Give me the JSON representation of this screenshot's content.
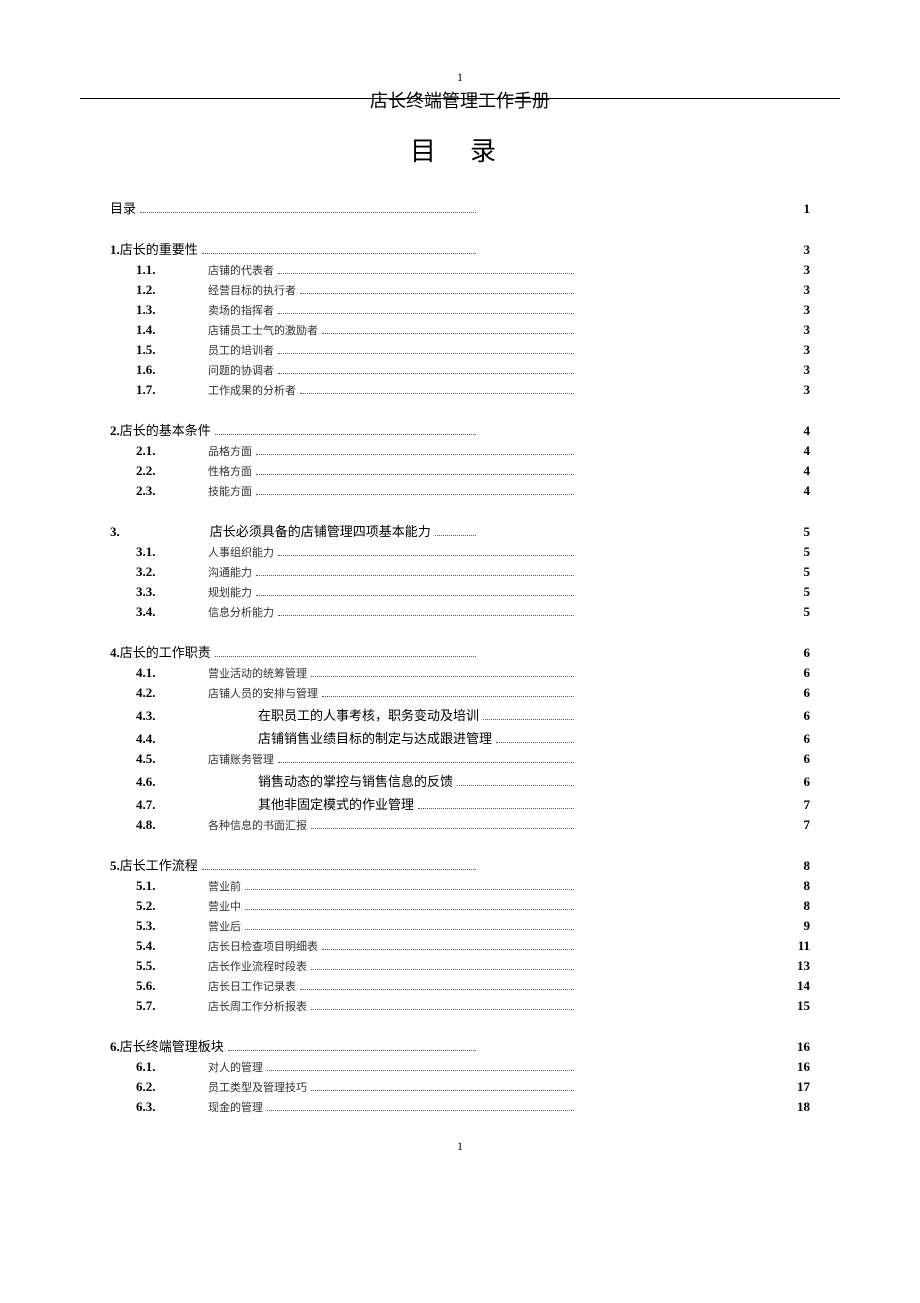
{
  "header": {
    "topnum": "1",
    "title": "店长终端管理工作手册"
  },
  "main_title": "目录",
  "footer": "1",
  "toc": [
    {
      "type": "top",
      "num": "",
      "label": "目录",
      "page": "1"
    },
    {
      "type": "top",
      "num": "1.",
      "label": "店长的重要性",
      "page": "3"
    },
    {
      "type": "sub",
      "num": "1.1.",
      "label": "店铺的代表者",
      "page": "3"
    },
    {
      "type": "sub",
      "num": "1.2.",
      "label": "经营目标的执行者",
      "page": "3"
    },
    {
      "type": "sub",
      "num": "1.3.",
      "label": "卖场的指挥者",
      "page": "3"
    },
    {
      "type": "sub",
      "num": "1.4.",
      "label": "店铺员工士气的激励者",
      "page": "3"
    },
    {
      "type": "sub",
      "num": "1.5.",
      "label": "员工的培训者",
      "page": "3"
    },
    {
      "type": "sub",
      "num": "1.6.",
      "label": "问题的协调者",
      "page": "3"
    },
    {
      "type": "sub",
      "num": "1.7.",
      "label": "工作成果的分析者",
      "page": "3"
    },
    {
      "type": "top",
      "num": "2.",
      "label": "店长的基本条件",
      "page": "4"
    },
    {
      "type": "sub",
      "num": "2.1.",
      "label": "品格方面",
      "page": "4"
    },
    {
      "type": "sub",
      "num": "2.2.",
      "label": "性格方面",
      "page": "4"
    },
    {
      "type": "sub",
      "num": "2.3.",
      "label": "技能方面",
      "page": "4"
    },
    {
      "type": "top-big",
      "num": "3.",
      "label": "店长必须具备的店铺管理四项基本能力",
      "page": "5"
    },
    {
      "type": "sub",
      "num": "3.1.",
      "label": "人事组织能力",
      "page": "5"
    },
    {
      "type": "sub",
      "num": "3.2.",
      "label": "沟通能力",
      "page": "5"
    },
    {
      "type": "sub",
      "num": "3.3.",
      "label": "规划能力",
      "page": "5"
    },
    {
      "type": "sub",
      "num": "3.4.",
      "label": "信息分析能力",
      "page": "5"
    },
    {
      "type": "top",
      "num": "4.",
      "label": "店长的工作职责",
      "page": "6"
    },
    {
      "type": "sub",
      "num": "4.1.",
      "label": "营业活动的统筹管理",
      "page": "6"
    },
    {
      "type": "sub",
      "num": "4.2.",
      "label": "店铺人员的安排与管理",
      "page": "6"
    },
    {
      "type": "sub-big",
      "num": "4.3.",
      "label": "在职员工的人事考核，职务变动及培训",
      "page": "6"
    },
    {
      "type": "sub-big",
      "num": "4.4.",
      "label": "店铺销售业绩目标的制定与达成跟进管理",
      "page": "6"
    },
    {
      "type": "sub",
      "num": "4.5.",
      "label": "店铺账务管理",
      "page": "6"
    },
    {
      "type": "sub-big",
      "num": "4.6.",
      "label": "销售动态的掌控与销售信息的反馈",
      "page": "6"
    },
    {
      "type": "sub-big",
      "num": "4.7.",
      "label": "其他非固定模式的作业管理",
      "page": "7"
    },
    {
      "type": "sub",
      "num": "4.8.",
      "label": "各种信息的书面汇报",
      "page": "7"
    },
    {
      "type": "top",
      "num": "5.",
      "label": "店长工作流程",
      "page": "8"
    },
    {
      "type": "sub",
      "num": "5.1.",
      "label": "营业前",
      "page": "8"
    },
    {
      "type": "sub",
      "num": "5.2.",
      "label": "营业中",
      "page": "8"
    },
    {
      "type": "sub",
      "num": "5.3.",
      "label": "营业后",
      "page": "9"
    },
    {
      "type": "sub",
      "num": "5.4.",
      "label": "店长日检查项目明细表",
      "page": "11"
    },
    {
      "type": "sub",
      "num": "5.5.",
      "label": "店长作业流程时段表",
      "page": "13"
    },
    {
      "type": "sub",
      "num": "5.6.",
      "label": "店长日工作记录表",
      "page": "14"
    },
    {
      "type": "sub",
      "num": "5.7.",
      "label": "店长周工作分析报表",
      "page": "15"
    },
    {
      "type": "top",
      "num": "6.",
      "label": "店长终端管理板块",
      "page": "16"
    },
    {
      "type": "sub",
      "num": "6.1.",
      "label": "对人的管理",
      "page": "16"
    },
    {
      "type": "sub",
      "num": "6.2.",
      "label": "员工类型及管理技巧",
      "page": "17"
    },
    {
      "type": "sub",
      "num": "6.3.",
      "label": "现金的管理",
      "page": "18"
    }
  ]
}
